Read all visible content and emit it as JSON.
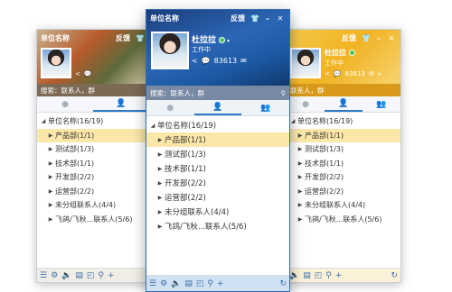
{
  "left": {
    "title": "单位名称",
    "feedback": "反馈",
    "search_placeholder": "搜索：联系人，群",
    "items": [
      {
        "label": "单位名称(16/19)",
        "level": "root",
        "selected": false
      },
      {
        "label": "产品部(1/1)",
        "level": "child",
        "selected": true
      },
      {
        "label": "测试部(1/3)",
        "level": "child",
        "selected": false
      },
      {
        "label": "技术部(1/1)",
        "level": "child",
        "selected": false
      },
      {
        "label": "开发部(2/2)",
        "level": "child",
        "selected": false
      },
      {
        "label": "运营部(2/2)",
        "level": "child",
        "selected": false
      },
      {
        "label": "未分组联系人(4/4)",
        "level": "child",
        "selected": false
      },
      {
        "label": "飞鸽/飞秋...联系人(5/6)",
        "level": "child",
        "selected": false
      }
    ]
  },
  "front": {
    "title": "单位名称",
    "feedback": "反馈",
    "user_name": "杜拉拉",
    "status": "工作中",
    "count": "83613",
    "search_placeholder": "搜索：联系人，群",
    "items": [
      {
        "label": "单位名称(16/19)",
        "level": "root",
        "selected": false
      },
      {
        "label": "产品部(1/1)",
        "level": "child",
        "selected": true
      },
      {
        "label": "测试部(1/3)",
        "level": "child",
        "selected": false
      },
      {
        "label": "技术部(1/1)",
        "level": "child",
        "selected": false
      },
      {
        "label": "开发部(2/2)",
        "level": "child",
        "selected": false
      },
      {
        "label": "运营部(2/2)",
        "level": "child",
        "selected": false
      },
      {
        "label": "未分组联系人(4/4)",
        "level": "child",
        "selected": false
      },
      {
        "label": "飞鸽/飞秋...联系人(5/6)",
        "level": "child",
        "selected": false
      }
    ]
  },
  "right": {
    "feedback": "反馈",
    "user_name": "杜拉拉",
    "status": "工作中",
    "count": "83613",
    "search_placeholder": "联系人，群",
    "items": [
      {
        "label": "单位名称(16/19)",
        "level": "root",
        "selected": false
      },
      {
        "label": "产品部(1/1)",
        "level": "child",
        "selected": true
      },
      {
        "label": "测试部(1/3)",
        "level": "child",
        "selected": false
      },
      {
        "label": "技术部(1/1)",
        "level": "child",
        "selected": false
      },
      {
        "label": "开发部(2/2)",
        "level": "child",
        "selected": false
      },
      {
        "label": "运营部(2/2)",
        "level": "child",
        "selected": false
      },
      {
        "label": "未分组联系人(4/4)",
        "level": "child",
        "selected": false
      },
      {
        "label": "飞鸽/飞秋...联系人(5/6)",
        "level": "child",
        "selected": false
      }
    ]
  },
  "icons": {
    "tabs": [
      "chat-icon",
      "contacts-icon",
      "group-icon"
    ],
    "footer": [
      "menu-icon",
      "settings-icon",
      "volume-icon",
      "folder-icon",
      "app-icon",
      "search-icon",
      "add-icon",
      "refresh-icon"
    ]
  },
  "colors": {
    "front_header": "#2b66b5",
    "left_header": "#b85a2c",
    "right_header": "#f1b323",
    "selected_row": "#fbe7a8",
    "active_tab": "#2c78c8"
  }
}
